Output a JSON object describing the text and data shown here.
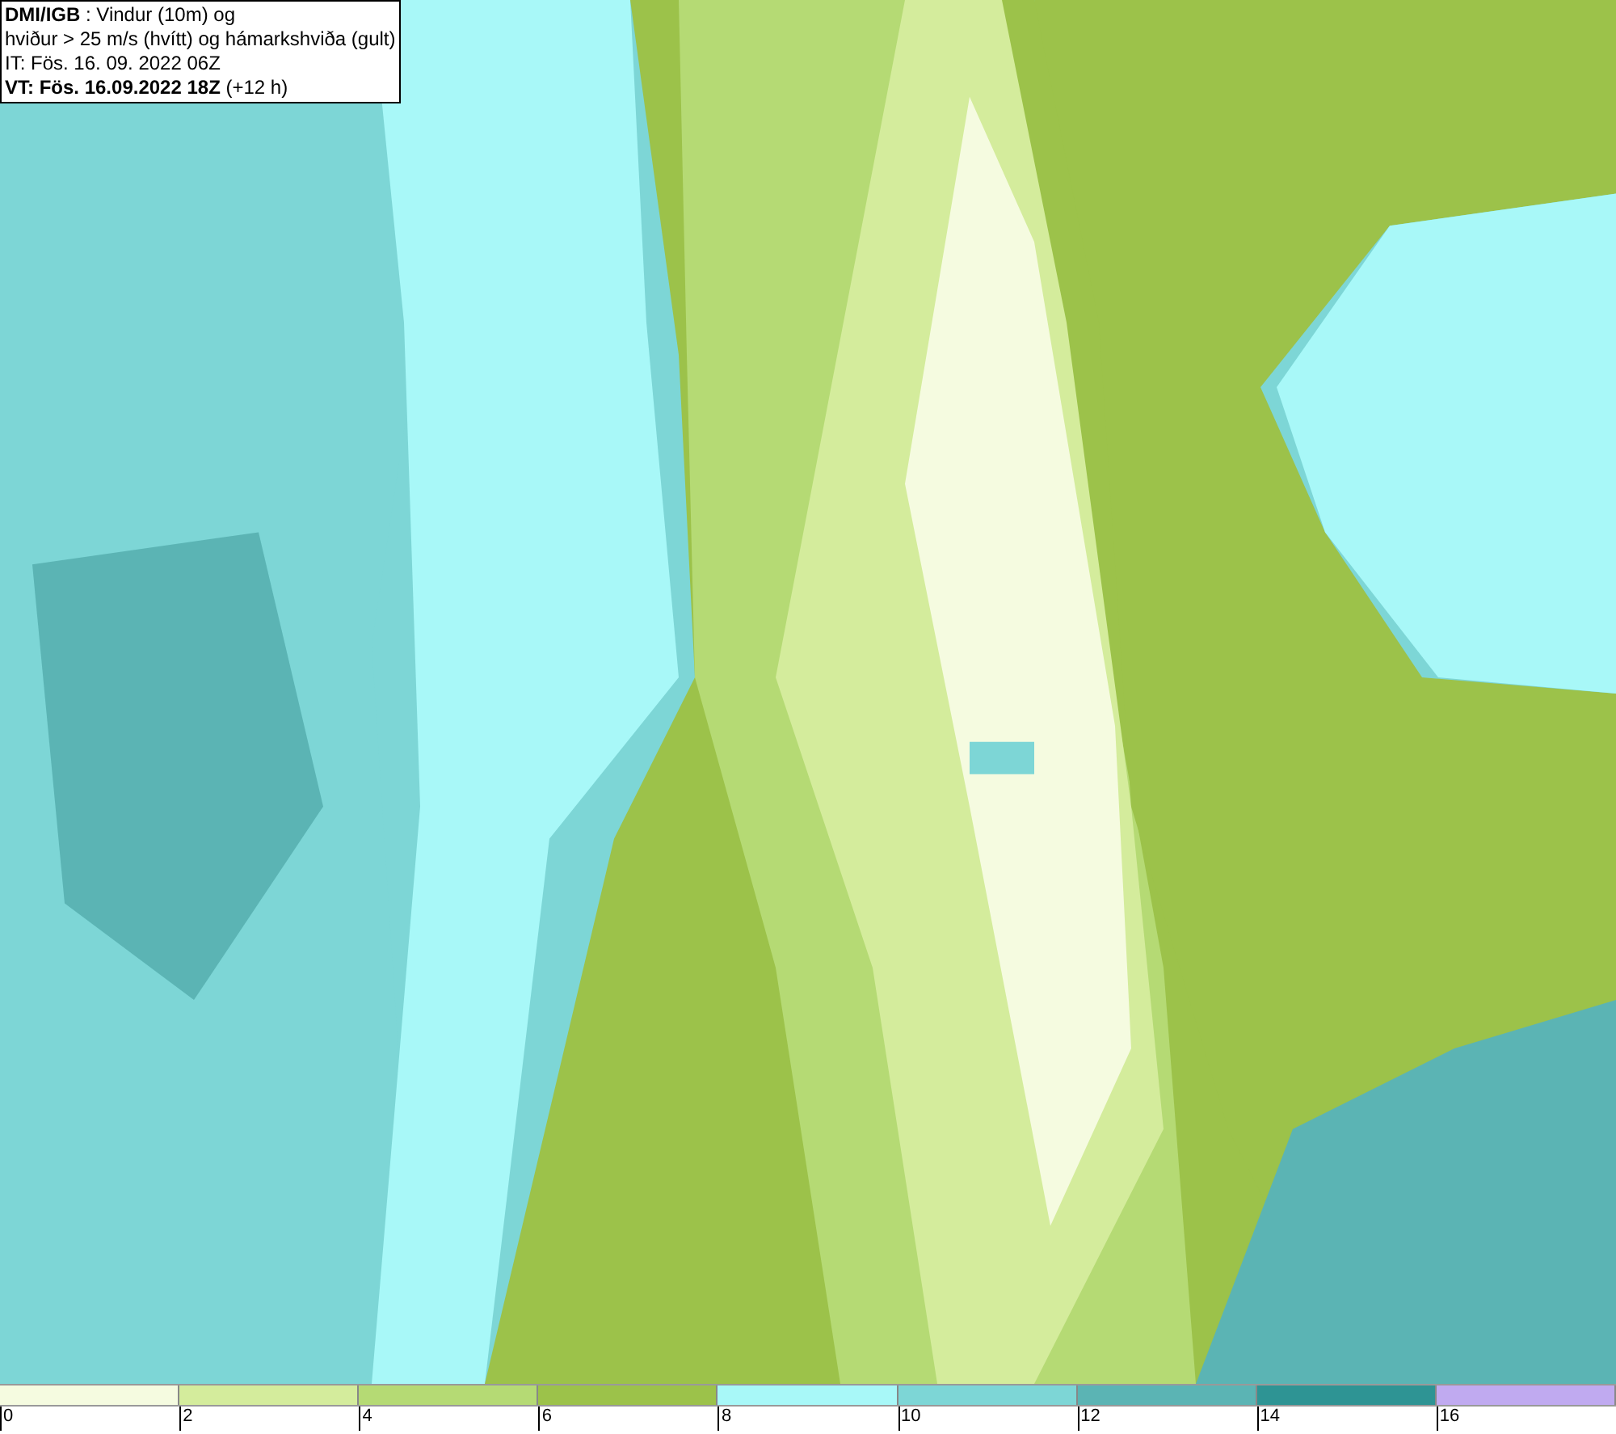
{
  "header": {
    "lines": [
      "**DMI/IGB** : Vindur (10m) og",
      "hviður > 25 m/s (hvítt) og hámarkshviða (gult)",
      "IT: Fös. 16. 09. 2022 06Z",
      "**VT: Fös. 16.09.2022 18Z** (+12 h)"
    ]
  },
  "legend": {
    "swatches": [
      {
        "color": "#f5fbe0"
      },
      {
        "color": "#d4ec9c"
      },
      {
        "color": "#b5da74"
      },
      {
        "color": "#9cc24a"
      },
      {
        "color": "#a8f8f8"
      },
      {
        "color": "#7dd6d6"
      },
      {
        "color": "#5bb4b4"
      },
      {
        "color": "#2e9494"
      },
      {
        "color": "#c0aaf0"
      }
    ],
    "labels": [
      "0",
      "2",
      "4",
      "6",
      "8",
      "10",
      "12",
      "14",
      "16"
    ]
  }
}
